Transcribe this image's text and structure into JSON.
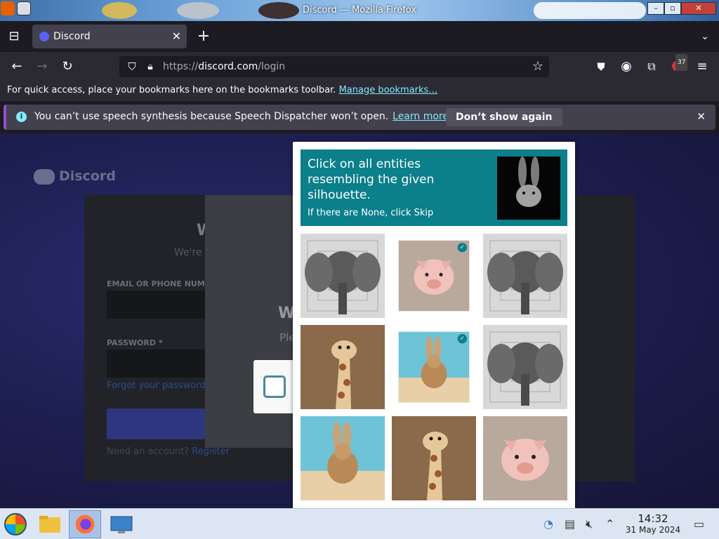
{
  "window": {
    "title": "Discord — Mozilla Firefox"
  },
  "tab": {
    "label": "Discord"
  },
  "nav": {
    "url_scheme": "https://",
    "url_host": "discord.com",
    "url_path": "/login",
    "extensions_badge": "37"
  },
  "bookmarks": {
    "text": "For quick access, place your bookmarks here on the bookmarks toolbar.",
    "link": "Manage bookmarks…"
  },
  "notification": {
    "message": "You can’t use speech synthesis because Speech Dispatcher won’t open.",
    "learn_more": "Learn more",
    "dont_show": "Don’t show again"
  },
  "page": {
    "logo": "Discord",
    "heading_fragment": "W",
    "sub_fragment": "We're s",
    "email_label": "EMAIL OR PHONE NUMB",
    "password_label": "PASSWORD *",
    "forgot": "Forgot your password?",
    "need_account": "Need an account?",
    "register": "Register",
    "modal_heading_fragment": "W",
    "modal_text_fragment": "Ple"
  },
  "captcha": {
    "prompt": "Click on all entities resembling the given silhouette.",
    "skip_hint": "If there are None, click Skip",
    "sample": "rabbit-silhouette",
    "tiles": [
      {
        "subject": "elephant",
        "selected": false
      },
      {
        "subject": "pig",
        "selected": true
      },
      {
        "subject": "elephant",
        "selected": false
      },
      {
        "subject": "giraffe",
        "selected": false
      },
      {
        "subject": "rabbit",
        "selected": true
      },
      {
        "subject": "elephant",
        "selected": false
      },
      {
        "subject": "rabbit",
        "selected": false
      },
      {
        "subject": "giraffe",
        "selected": false
      },
      {
        "subject": "pig",
        "selected": false
      }
    ]
  },
  "taskbar": {
    "time": "14:32",
    "date": "31 May 2024"
  }
}
